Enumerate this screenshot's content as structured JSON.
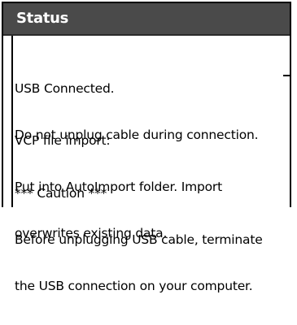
{
  "window": {
    "title": "Status"
  },
  "messages": [
    {
      "lines": [
        "USB Connected.",
        "Do not unplug cable during connection."
      ]
    },
    {
      "lines": [
        "VCP file import:",
        "Put into AutoImport folder. Import",
        "overwrites existing data."
      ]
    },
    {
      "lines": [
        "*** Caution ***",
        "Before unplugging USB cable, terminate",
        "the USB connection on your computer."
      ]
    }
  ]
}
